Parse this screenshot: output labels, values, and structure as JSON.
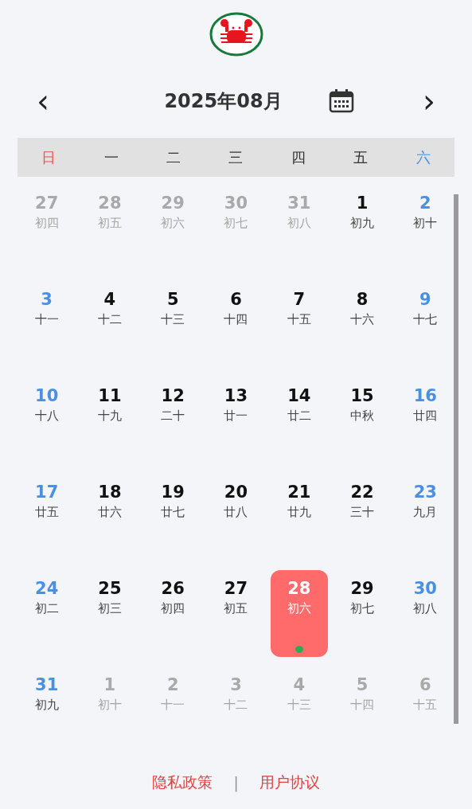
{
  "header": {
    "prev": "‹",
    "title": "2025年08月",
    "next": "›"
  },
  "weekdays": [
    {
      "label": "日",
      "kind": "sunday"
    },
    {
      "label": "一",
      "kind": "weekday"
    },
    {
      "label": "二",
      "kind": "weekday"
    },
    {
      "label": "三",
      "kind": "weekday"
    },
    {
      "label": "四",
      "kind": "weekday"
    },
    {
      "label": "五",
      "kind": "weekday"
    },
    {
      "label": "六",
      "kind": "saturday"
    }
  ],
  "days": [
    {
      "day": "27",
      "lunar": "初四",
      "in_month": false,
      "selected": false,
      "has_event": false
    },
    {
      "day": "28",
      "lunar": "初五",
      "in_month": false,
      "selected": false,
      "has_event": false
    },
    {
      "day": "29",
      "lunar": "初六",
      "in_month": false,
      "selected": false,
      "has_event": false
    },
    {
      "day": "30",
      "lunar": "初七",
      "in_month": false,
      "selected": false,
      "has_event": false
    },
    {
      "day": "31",
      "lunar": "初八",
      "in_month": false,
      "selected": false,
      "has_event": false
    },
    {
      "day": "1",
      "lunar": "初九",
      "in_month": true,
      "selected": false,
      "has_event": false
    },
    {
      "day": "2",
      "lunar": "初十",
      "in_month": true,
      "selected": false,
      "has_event": false
    },
    {
      "day": "3",
      "lunar": "十一",
      "in_month": true,
      "selected": false,
      "has_event": false
    },
    {
      "day": "4",
      "lunar": "十二",
      "in_month": true,
      "selected": false,
      "has_event": false
    },
    {
      "day": "5",
      "lunar": "十三",
      "in_month": true,
      "selected": false,
      "has_event": false
    },
    {
      "day": "6",
      "lunar": "十四",
      "in_month": true,
      "selected": false,
      "has_event": false
    },
    {
      "day": "7",
      "lunar": "十五",
      "in_month": true,
      "selected": false,
      "has_event": false
    },
    {
      "day": "8",
      "lunar": "十六",
      "in_month": true,
      "selected": false,
      "has_event": false
    },
    {
      "day": "9",
      "lunar": "十七",
      "in_month": true,
      "selected": false,
      "has_event": false
    },
    {
      "day": "10",
      "lunar": "十八",
      "in_month": true,
      "selected": false,
      "has_event": false
    },
    {
      "day": "11",
      "lunar": "十九",
      "in_month": true,
      "selected": false,
      "has_event": false
    },
    {
      "day": "12",
      "lunar": "二十",
      "in_month": true,
      "selected": false,
      "has_event": false
    },
    {
      "day": "13",
      "lunar": "廿一",
      "in_month": true,
      "selected": false,
      "has_event": false
    },
    {
      "day": "14",
      "lunar": "廿二",
      "in_month": true,
      "selected": false,
      "has_event": false
    },
    {
      "day": "15",
      "lunar": "中秋",
      "in_month": true,
      "selected": false,
      "has_event": false
    },
    {
      "day": "16",
      "lunar": "廿四",
      "in_month": true,
      "selected": false,
      "has_event": false
    },
    {
      "day": "17",
      "lunar": "廿五",
      "in_month": true,
      "selected": false,
      "has_event": false
    },
    {
      "day": "18",
      "lunar": "廿六",
      "in_month": true,
      "selected": false,
      "has_event": false
    },
    {
      "day": "19",
      "lunar": "廿七",
      "in_month": true,
      "selected": false,
      "has_event": false
    },
    {
      "day": "20",
      "lunar": "廿八",
      "in_month": true,
      "selected": false,
      "has_event": false
    },
    {
      "day": "21",
      "lunar": "廿九",
      "in_month": true,
      "selected": false,
      "has_event": false
    },
    {
      "day": "22",
      "lunar": "三十",
      "in_month": true,
      "selected": false,
      "has_event": false
    },
    {
      "day": "23",
      "lunar": "九月",
      "in_month": true,
      "selected": false,
      "has_event": false
    },
    {
      "day": "24",
      "lunar": "初二",
      "in_month": true,
      "selected": false,
      "has_event": false
    },
    {
      "day": "25",
      "lunar": "初三",
      "in_month": true,
      "selected": false,
      "has_event": false
    },
    {
      "day": "26",
      "lunar": "初四",
      "in_month": true,
      "selected": false,
      "has_event": false
    },
    {
      "day": "27",
      "lunar": "初五",
      "in_month": true,
      "selected": false,
      "has_event": false
    },
    {
      "day": "28",
      "lunar": "初六",
      "in_month": true,
      "selected": true,
      "has_event": true
    },
    {
      "day": "29",
      "lunar": "初七",
      "in_month": true,
      "selected": false,
      "has_event": false
    },
    {
      "day": "30",
      "lunar": "初八",
      "in_month": true,
      "selected": false,
      "has_event": false
    },
    {
      "day": "31",
      "lunar": "初九",
      "in_month": true,
      "selected": false,
      "has_event": false
    },
    {
      "day": "1",
      "lunar": "初十",
      "in_month": false,
      "selected": false,
      "has_event": false
    },
    {
      "day": "2",
      "lunar": "十一",
      "in_month": false,
      "selected": false,
      "has_event": false
    },
    {
      "day": "3",
      "lunar": "十二",
      "in_month": false,
      "selected": false,
      "has_event": false
    },
    {
      "day": "4",
      "lunar": "十三",
      "in_month": false,
      "selected": false,
      "has_event": false
    },
    {
      "day": "5",
      "lunar": "十四",
      "in_month": false,
      "selected": false,
      "has_event": false
    },
    {
      "day": "6",
      "lunar": "十五",
      "in_month": false,
      "selected": false,
      "has_event": false
    }
  ],
  "footer": {
    "links": [
      "隐私政策",
      "用户协议"
    ],
    "separator": "|"
  }
}
